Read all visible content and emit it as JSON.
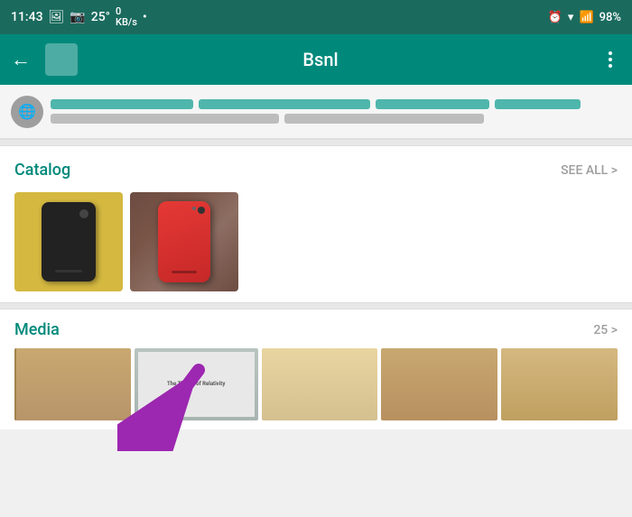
{
  "statusBar": {
    "time": "11:43",
    "icons": [
      "image",
      "camera",
      "temp",
      "data",
      "dot"
    ],
    "temp": "25°",
    "data": "0\nKB/s",
    "rightIcons": [
      "alarm",
      "wifi",
      "signal",
      "battery"
    ],
    "battery": "98%"
  },
  "appBar": {
    "title": "Bsnl",
    "backLabel": "←",
    "moreLabel": "⋮"
  },
  "catalog": {
    "sectionTitle": "Catalog",
    "seeAllLabel": "SEE ALL >",
    "images": [
      {
        "id": "phone-dark",
        "alt": "Dark phone on yellow background"
      },
      {
        "id": "phone-red",
        "alt": "Red phone on stone background"
      }
    ]
  },
  "media": {
    "sectionTitle": "Media",
    "countLabel": "25 >",
    "thumbs": [
      {
        "id": "book1",
        "alt": "Book thumbnail 1"
      },
      {
        "id": "book2",
        "alt": "The Theory of Relativity book"
      },
      {
        "id": "book3",
        "alt": "Book thumbnail 3"
      },
      {
        "id": "book4",
        "alt": "Book thumbnail 4"
      },
      {
        "id": "book5",
        "alt": "Book thumbnail 5"
      }
    ]
  },
  "arrow": {
    "color": "#9c4dcc",
    "direction": "up-right"
  }
}
